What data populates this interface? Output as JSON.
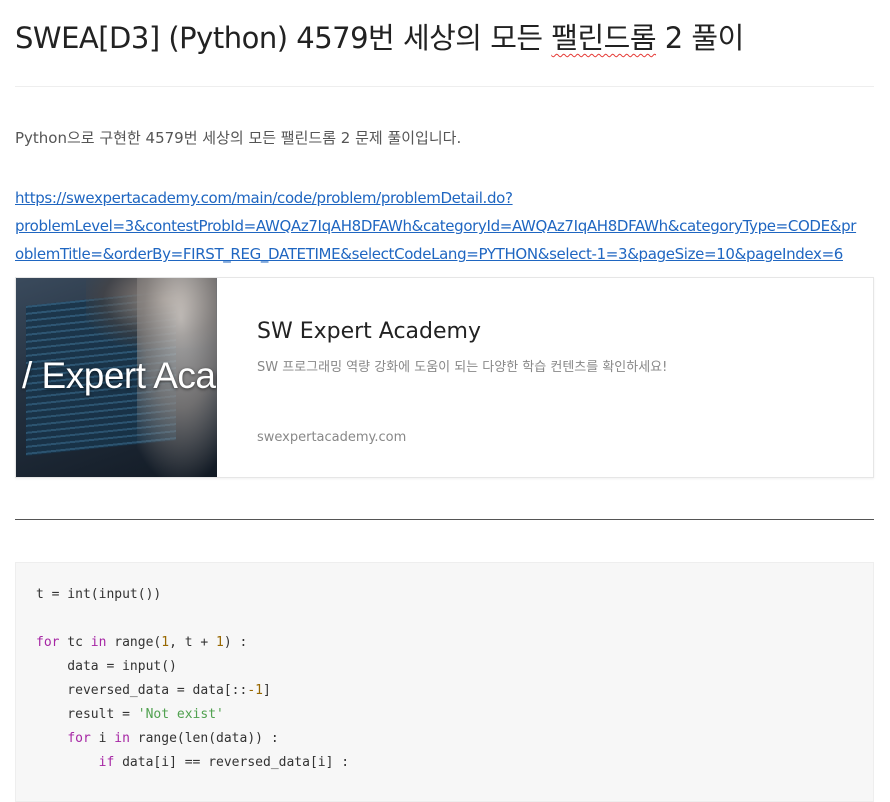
{
  "post": {
    "title": {
      "prefix": "SWEA[D3] (Python) 4579번 세상의 모든 ",
      "flagged_word": "팰린드롬",
      "suffix": " 2 풀이"
    },
    "intro": "Python으로 구현한 4579번 세상의 모든 팰린드롬 2 문제 풀이입니다.",
    "link_lines": [
      "https://swexpertacademy.com/main/code/problem/problemDetail.do?",
      "problemLevel=3&contestProbId=AWQAz7IqAH8DFAWh&categoryId=AWQAz7IqAH8DFAWh&categoryType=CODE&pr",
      "oblemTitle=&orderBy=FIRST_REG_DATETIME&selectCodeLang=PYTHON&select-1=3&pageSize=10&pageIndex=6"
    ]
  },
  "og_card": {
    "thumbnail_text": "/ Expert Acade",
    "title": "SW Expert Academy",
    "description": "SW 프로그래밍 역량 강화에 도움이 되는 다양한 학습 컨텐츠를 확인하세요!",
    "domain": "swexpertacademy.com"
  },
  "code": {
    "line1": {
      "a": "t = int(input())"
    },
    "line2": {
      "a": ""
    },
    "line3": {
      "kw1": "for",
      "a": " tc ",
      "kw2": "in",
      "b": " range(",
      "n1": "1",
      "c": ", t + ",
      "n2": "1",
      "d": ") :"
    },
    "line4": {
      "a": "    data = input()"
    },
    "line5": {
      "a": "    reversed_data = data[::",
      "n1": "-1",
      "b": "]"
    },
    "line6": {
      "a": "    result = ",
      "s1": "'Not exist'"
    },
    "line7": {
      "a": "    ",
      "kw1": "for",
      "b": " i ",
      "kw2": "in",
      "c": " range(len(data)) :"
    },
    "line8": {
      "a": "        ",
      "kw1": "if",
      "b": " data[i] == reversed_data[i] :"
    }
  },
  "colors": {
    "link": "#1f66c1",
    "keyword": "#a626a4",
    "number": "#986801",
    "string": "#50a14f"
  }
}
